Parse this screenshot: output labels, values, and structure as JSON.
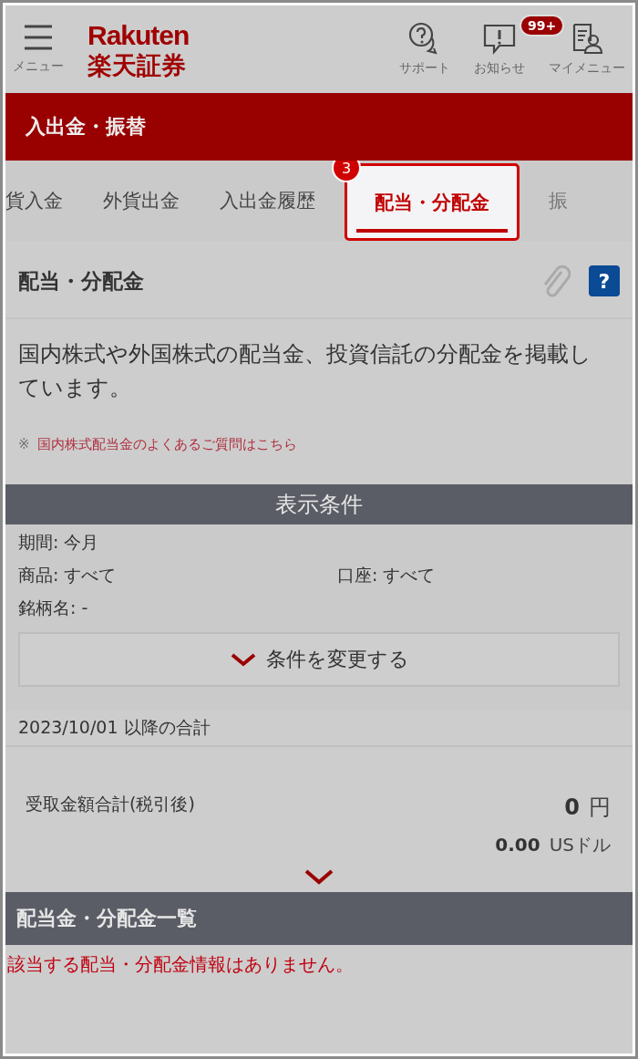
{
  "header": {
    "menu_label": "メニュー",
    "logo_top": "Rakuten",
    "logo_bottom": "楽天証券",
    "actions": [
      {
        "kind": "support",
        "label": "サポート"
      },
      {
        "kind": "notice",
        "label": "お知らせ",
        "badge": "99+"
      },
      {
        "kind": "mymenu",
        "label": "マイメニュー"
      }
    ]
  },
  "title_bar": "入出金・振替",
  "tabs": [
    {
      "label": "貨入金",
      "selected": false
    },
    {
      "label": "外貨出金",
      "selected": false
    },
    {
      "label": "入出金履歴",
      "selected": false
    },
    {
      "label": "配当・分配金",
      "selected": true,
      "step_badge": "3"
    },
    {
      "label": "振",
      "selected": false
    }
  ],
  "page_title": "配当・分配金",
  "help_icon": "?",
  "description": "国内株式や外国株式の配当金、投資信託の分配金を掲載しています。",
  "note": {
    "mark": "※",
    "link": "国内株式配当金のよくあるご質問はこちら"
  },
  "conditions": {
    "heading": "表示条件",
    "period": "期間: 今月",
    "product": "商品: すべて",
    "account": "口座: すべて",
    "name": "銘柄名: -",
    "change_button": "条件を変更する"
  },
  "total_heading": "2023/10/01 以降の合計",
  "totals": {
    "label": "受取金額合計(税引後)",
    "yen_value": "0",
    "yen_unit": "円",
    "usd_value": "0.00",
    "usd_unit": "USドル"
  },
  "list_heading": "配当金・分配金一覧",
  "empty_message": "該当する配当・分配金情報はありません。"
}
